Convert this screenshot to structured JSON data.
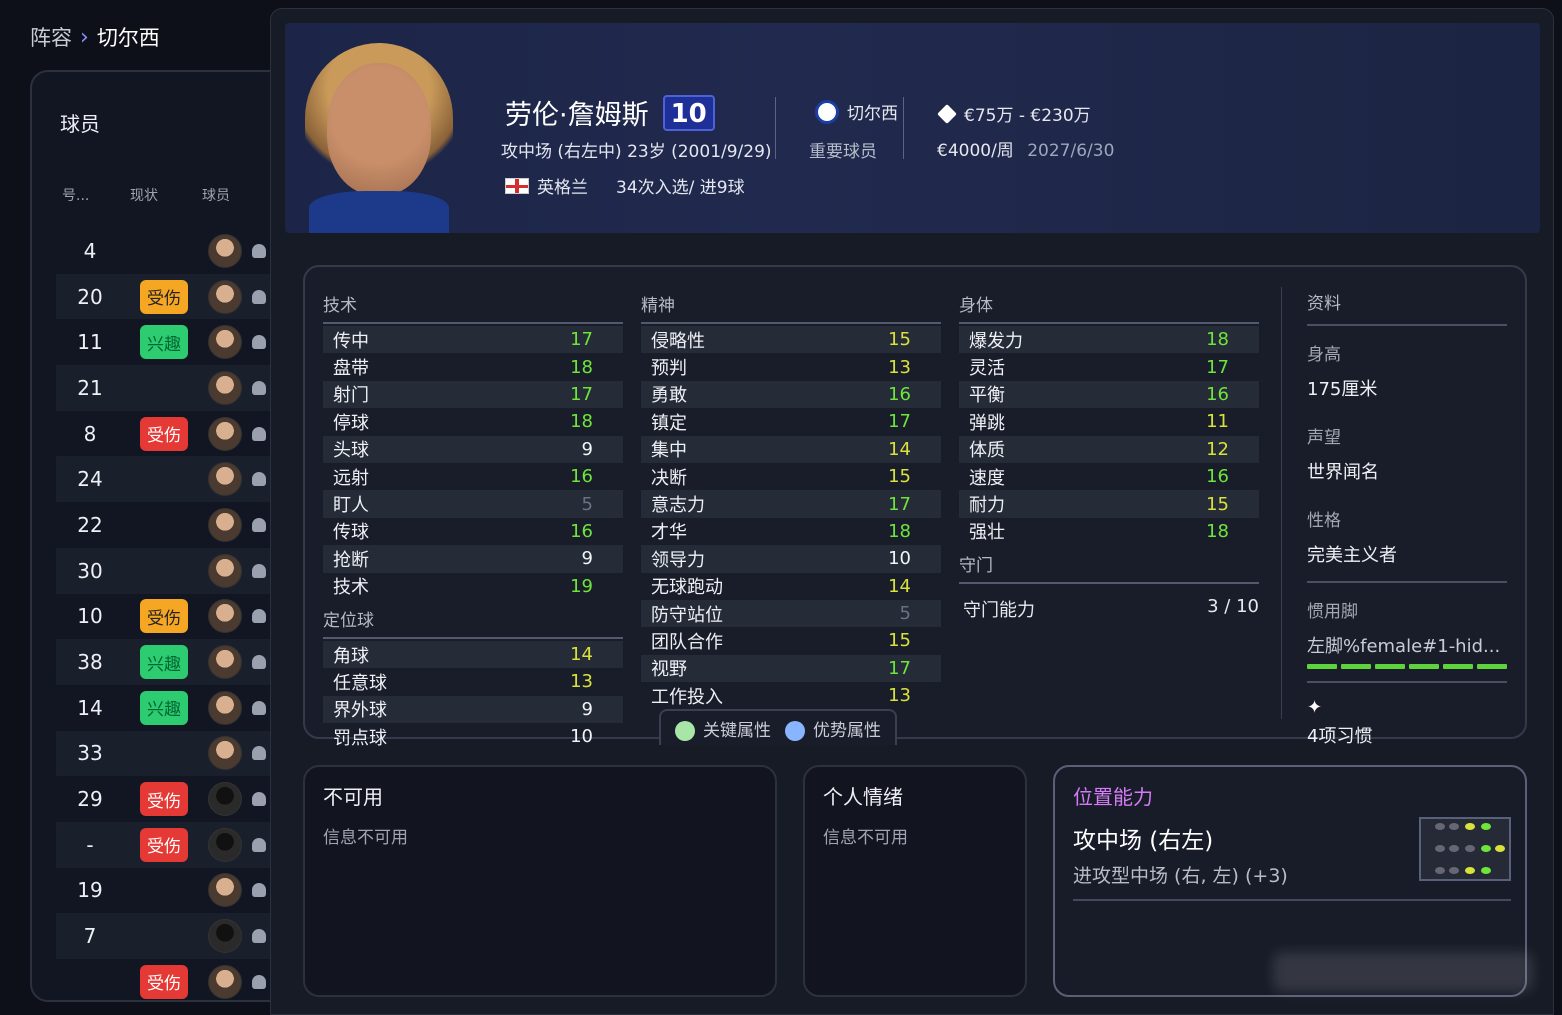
{
  "breadcrumb": {
    "root": "阵容",
    "current": "切尔西"
  },
  "roster": {
    "title": "球员",
    "columns": [
      "号...",
      "现状",
      "球员"
    ],
    "rows": [
      {
        "num": "4",
        "status": ""
      },
      {
        "num": "20",
        "status": "受伤",
        "type": "injury-o"
      },
      {
        "num": "11",
        "status": "兴趣",
        "type": "interest"
      },
      {
        "num": "21",
        "status": ""
      },
      {
        "num": "8",
        "status": "受伤",
        "type": "injury-r"
      },
      {
        "num": "24",
        "status": ""
      },
      {
        "num": "22",
        "status": ""
      },
      {
        "num": "30",
        "status": ""
      },
      {
        "num": "10",
        "status": "受伤",
        "type": "injury-o"
      },
      {
        "num": "38",
        "status": "兴趣",
        "type": "interest"
      },
      {
        "num": "14",
        "status": "兴趣",
        "type": "interest"
      },
      {
        "num": "33",
        "status": ""
      },
      {
        "num": "29",
        "status": "受伤",
        "type": "injury-r",
        "blank": true
      },
      {
        "num": "-",
        "status": "受伤",
        "type": "injury-r",
        "blank": true
      },
      {
        "num": "19",
        "status": ""
      },
      {
        "num": "7",
        "status": "",
        "blank": true
      },
      {
        "num": "",
        "status": "受伤",
        "type": "injury-r"
      }
    ]
  },
  "player": {
    "name": "劳伦·詹姆斯",
    "number": "10",
    "position_age": "攻中场 (右左中)  23岁 (2001/9/29)",
    "nation": "英格兰",
    "caps": "34次入选/ 进9球",
    "club": "切尔西",
    "role": "重要球员",
    "value": "€75万 - €230万",
    "wage": "€4000/周",
    "contract": "2027/6/30"
  },
  "attributes": {
    "technical": {
      "title": "技术",
      "items": [
        {
          "n": "传中",
          "v": "17",
          "c": "g"
        },
        {
          "n": "盘带",
          "v": "18",
          "c": "g"
        },
        {
          "n": "射门",
          "v": "17",
          "c": "g"
        },
        {
          "n": "停球",
          "v": "18",
          "c": "g"
        },
        {
          "n": "头球",
          "v": "9",
          "c": "w"
        },
        {
          "n": "远射",
          "v": "16",
          "c": "g"
        },
        {
          "n": "盯人",
          "v": "5",
          "c": "d"
        },
        {
          "n": "传球",
          "v": "16",
          "c": "g"
        },
        {
          "n": "抢断",
          "v": "9",
          "c": "w"
        },
        {
          "n": "技术",
          "v": "19",
          "c": "g"
        }
      ]
    },
    "setpieces": {
      "title": "定位球",
      "items": [
        {
          "n": "角球",
          "v": "14",
          "c": "y"
        },
        {
          "n": "任意球",
          "v": "13",
          "c": "y"
        },
        {
          "n": "界外球",
          "v": "9",
          "c": "w"
        },
        {
          "n": "罚点球",
          "v": "10",
          "c": "w"
        }
      ]
    },
    "mental": {
      "title": "精神",
      "items": [
        {
          "n": "侵略性",
          "v": "15",
          "c": "y"
        },
        {
          "n": "预判",
          "v": "13",
          "c": "y"
        },
        {
          "n": "勇敢",
          "v": "16",
          "c": "g"
        },
        {
          "n": "镇定",
          "v": "17",
          "c": "g"
        },
        {
          "n": "集中",
          "v": "14",
          "c": "y"
        },
        {
          "n": "决断",
          "v": "15",
          "c": "y"
        },
        {
          "n": "意志力",
          "v": "17",
          "c": "g"
        },
        {
          "n": "才华",
          "v": "18",
          "c": "g"
        },
        {
          "n": "领导力",
          "v": "10",
          "c": "w"
        },
        {
          "n": "无球跑动",
          "v": "14",
          "c": "y"
        },
        {
          "n": "防守站位",
          "v": "5",
          "c": "d"
        },
        {
          "n": "团队合作",
          "v": "15",
          "c": "y"
        },
        {
          "n": "视野",
          "v": "17",
          "c": "g"
        },
        {
          "n": "工作投入",
          "v": "13",
          "c": "y"
        }
      ]
    },
    "physical": {
      "title": "身体",
      "items": [
        {
          "n": "爆发力",
          "v": "18",
          "c": "g"
        },
        {
          "n": "灵活",
          "v": "17",
          "c": "g"
        },
        {
          "n": "平衡",
          "v": "16",
          "c": "g"
        },
        {
          "n": "弹跳",
          "v": "11",
          "c": "y"
        },
        {
          "n": "体质",
          "v": "12",
          "c": "y"
        },
        {
          "n": "速度",
          "v": "16",
          "c": "g"
        },
        {
          "n": "耐力",
          "v": "15",
          "c": "y"
        },
        {
          "n": "强壮",
          "v": "18",
          "c": "g"
        }
      ]
    },
    "goalkeeping": {
      "title": "守门",
      "label": "守门能力",
      "value": "3 / 10"
    },
    "legend": {
      "key": "关键属性",
      "advantage": "优势属性"
    }
  },
  "info": {
    "title": "资料",
    "height_label": "身高",
    "height": "175厘米",
    "rep_label": "声望",
    "rep": "世界闻名",
    "personality_label": "性格",
    "personality": "完美主义者",
    "foot_label": "惯用脚",
    "foot": "左脚%female#1-hid...",
    "traits": "4项习惯"
  },
  "cards": {
    "unavailable": {
      "title": "不可用",
      "text": "信息不可用"
    },
    "mood": {
      "title": "个人情绪",
      "text": "信息不可用"
    },
    "position": {
      "title": "位置能力",
      "main": "攻中场 (右左)",
      "sub": "进攻型中场 (右, 左) (+3)"
    }
  }
}
